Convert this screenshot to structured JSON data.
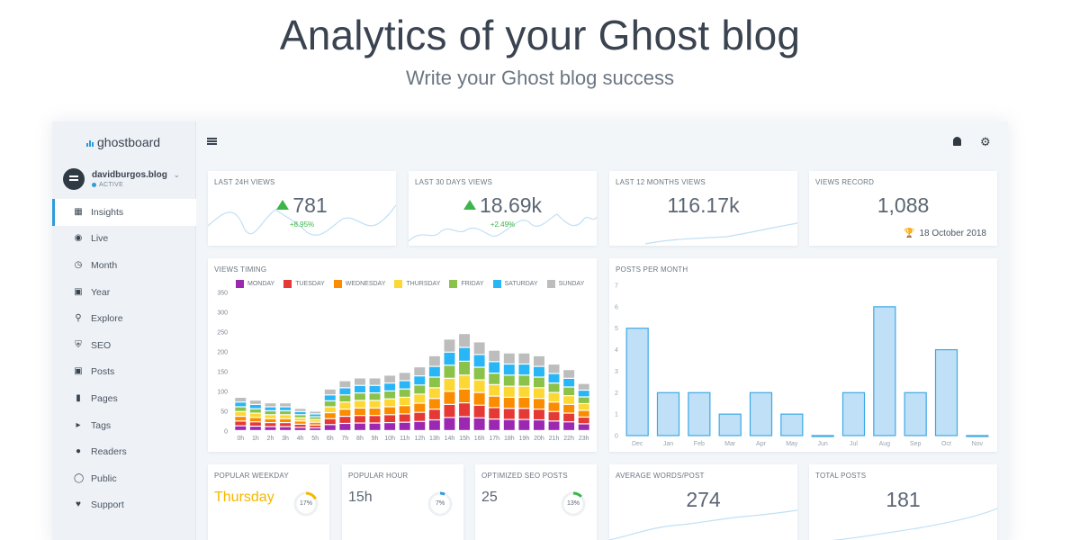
{
  "hero": {
    "title": "Analytics of your Ghost blog",
    "subtitle": "Write your Ghost blog success"
  },
  "sidebar": {
    "brand": "ghostboard",
    "site_name": "davidburgos.blog",
    "site_status": "ACTIVE",
    "items": [
      {
        "label": "Insights",
        "icon": "dashboard-icon",
        "active": true
      },
      {
        "label": "Live",
        "icon": "live-icon"
      },
      {
        "label": "Month",
        "icon": "clock-icon"
      },
      {
        "label": "Year",
        "icon": "calendar-icon"
      },
      {
        "label": "Explore",
        "icon": "search-icon"
      },
      {
        "label": "SEO",
        "icon": "shield-icon"
      },
      {
        "label": "Posts",
        "icon": "document-icon"
      },
      {
        "label": "Pages",
        "icon": "bookmark-icon"
      },
      {
        "label": "Tags",
        "icon": "tag-icon"
      },
      {
        "label": "Readers",
        "icon": "users-icon"
      },
      {
        "label": "Public",
        "icon": "globe-icon"
      },
      {
        "label": "Support",
        "icon": "heart-icon"
      }
    ]
  },
  "stats": {
    "views_24h": {
      "label": "LAST 24H VIEWS",
      "value": "781",
      "delta": "+8.95%"
    },
    "views_30d": {
      "label": "LAST 30 DAYS VIEWS",
      "value": "18.69k",
      "delta": "+2.49%"
    },
    "views_12m": {
      "label": "LAST 12 MONTHS VIEWS",
      "value": "116.17k"
    },
    "record": {
      "label": "VIEWS RECORD",
      "value": "1,088",
      "date": "18 October 2018"
    }
  },
  "views_timing": {
    "label": "VIEWS TIMING",
    "legend": [
      {
        "name": "MONDAY",
        "color": "#9c27b0"
      },
      {
        "name": "TUESDAY",
        "color": "#e53935"
      },
      {
        "name": "WEDNESDAY",
        "color": "#fb8c00"
      },
      {
        "name": "THURSDAY",
        "color": "#fdd835"
      },
      {
        "name": "FRIDAY",
        "color": "#8bc34a"
      },
      {
        "name": "SATURDAY",
        "color": "#29b6f6"
      },
      {
        "name": "SUNDAY",
        "color": "#bdbdbd"
      }
    ]
  },
  "posts_per_month": {
    "label": "POSTS PER MONTH"
  },
  "bottom": {
    "weekday": {
      "label": "POPULAR WEEKDAY",
      "value": "Thursday",
      "percent": "17%",
      "fraction": 0.17,
      "color": "#f5b800"
    },
    "hour": {
      "label": "POPULAR HOUR",
      "value": "15h",
      "percent": "7%",
      "fraction": 0.07,
      "color": "#2d9cdb"
    },
    "seo": {
      "label": "OPTIMIZED SEO POSTS",
      "value": "25",
      "percent": "13%",
      "fraction": 0.13,
      "color": "#3cb54a"
    },
    "words": {
      "label": "AVERAGE WORDS/POST",
      "value": "274"
    },
    "total": {
      "label": "TOTAL POSTS",
      "value": "181"
    }
  },
  "chart_data": [
    {
      "type": "bar",
      "stacked": true,
      "title": "VIEWS TIMING",
      "categories": [
        "0h",
        "1h",
        "2h",
        "3h",
        "4h",
        "5h",
        "6h",
        "7h",
        "8h",
        "9h",
        "10h",
        "11h",
        "12h",
        "13h",
        "14h",
        "15h",
        "16h",
        "17h",
        "18h",
        "19h",
        "20h",
        "21h",
        "22h",
        "23h"
      ],
      "ylim": [
        0,
        350
      ],
      "yticks": [
        0,
        50,
        100,
        150,
        200,
        250,
        300,
        350
      ],
      "grid": false,
      "legend": "top",
      "series": [
        {
          "name": "MONDAY",
          "color": "#9c27b0",
          "values": [
            12,
            11,
            10,
            10,
            8,
            7,
            15,
            18,
            19,
            19,
            20,
            21,
            23,
            27,
            33,
            35,
            32,
            29,
            28,
            28,
            27,
            24,
            22,
            17
          ]
        },
        {
          "name": "TUESDAY",
          "color": "#e53935",
          "values": [
            12,
            11,
            10,
            10,
            8,
            7,
            15,
            18,
            19,
            19,
            20,
            21,
            23,
            27,
            33,
            35,
            32,
            29,
            28,
            28,
            27,
            24,
            22,
            17
          ]
        },
        {
          "name": "WEDNESDAY",
          "color": "#fb8c00",
          "values": [
            12,
            11,
            10,
            10,
            8,
            7,
            15,
            18,
            19,
            19,
            20,
            21,
            23,
            27,
            33,
            35,
            32,
            29,
            28,
            28,
            27,
            24,
            22,
            17
          ]
        },
        {
          "name": "THURSDAY",
          "color": "#fdd835",
          "values": [
            12,
            11,
            10,
            10,
            8,
            7,
            15,
            18,
            19,
            19,
            20,
            21,
            23,
            27,
            33,
            35,
            32,
            29,
            28,
            28,
            27,
            24,
            22,
            17
          ]
        },
        {
          "name": "FRIDAY",
          "color": "#8bc34a",
          "values": [
            12,
            11,
            10,
            10,
            8,
            7,
            15,
            18,
            19,
            19,
            20,
            21,
            23,
            27,
            33,
            35,
            32,
            29,
            28,
            28,
            27,
            24,
            22,
            17
          ]
        },
        {
          "name": "SATURDAY",
          "color": "#29b6f6",
          "values": [
            12,
            11,
            10,
            10,
            8,
            7,
            15,
            18,
            19,
            19,
            20,
            21,
            23,
            27,
            33,
            35,
            32,
            29,
            28,
            28,
            27,
            24,
            22,
            17
          ]
        },
        {
          "name": "SUNDAY",
          "color": "#bdbdbd",
          "values": [
            12,
            11,
            10,
            10,
            8,
            7,
            15,
            18,
            19,
            19,
            20,
            21,
            23,
            27,
            33,
            35,
            32,
            29,
            28,
            28,
            27,
            24,
            22,
            17
          ]
        }
      ]
    },
    {
      "type": "bar",
      "title": "POSTS PER MONTH",
      "categories": [
        "Dec",
        "Jan",
        "Feb",
        "Mar",
        "Apr",
        "May",
        "Jun",
        "Jul",
        "Aug",
        "Sep",
        "Oct",
        "Nov"
      ],
      "values": [
        5,
        2,
        2,
        1,
        2,
        1,
        0,
        2,
        6,
        2,
        4,
        0
      ],
      "ylim": [
        0,
        7
      ],
      "yticks": [
        0,
        1,
        2,
        3,
        4,
        5,
        6,
        7
      ],
      "grid": false
    }
  ]
}
